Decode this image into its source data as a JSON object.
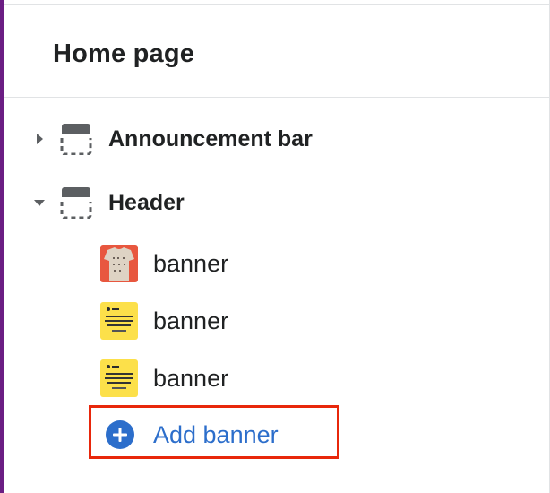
{
  "page": {
    "title": "Home page"
  },
  "sections": [
    {
      "label": "Announcement bar",
      "expanded": false,
      "icon": "section-layout-icon"
    },
    {
      "label": "Header",
      "expanded": true,
      "icon": "section-layout-icon"
    }
  ],
  "blocks": [
    {
      "label": "banner",
      "thumbnail": "tshirt-thumbnail"
    },
    {
      "label": "banner",
      "thumbnail": "yellow-promo-thumbnail"
    },
    {
      "label": "banner",
      "thumbnail": "yellow-promo-thumbnail"
    }
  ],
  "add_block": {
    "label": "Add banner",
    "icon": "plus-circle-icon"
  },
  "colors": {
    "accent": "#2c6ecb",
    "highlight_box": "#e8270b",
    "sidebar_edge": "#6b1d83",
    "text": "#202223"
  }
}
